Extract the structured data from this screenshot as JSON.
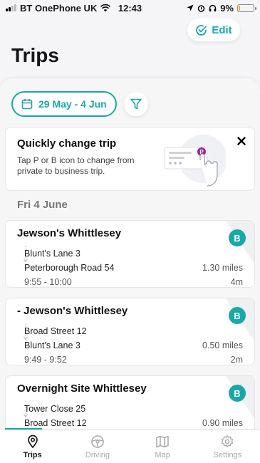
{
  "status_bar": {
    "carrier": "BT OnePhone UK",
    "time": "12:43",
    "battery_percent": "9%",
    "battery_level": 0.09
  },
  "header": {
    "edit_label": "Edit",
    "title": "Trips"
  },
  "filters": {
    "date_range": "29 May - 4 Jun"
  },
  "tip": {
    "title": "Quickly change trip",
    "body": "Tap P or B icon to change from private to business trip.",
    "badge_letter": "P"
  },
  "day_header": "Fri 4 June",
  "trips": [
    {
      "title": "Jewson's Whittlesey",
      "badge": "B",
      "from": "Blunt's Lane 3",
      "to": "Peterborough Road 54",
      "distance": "1.30 miles",
      "time_range": "9:55 - 10:00",
      "duration": "4m"
    },
    {
      "title": "- Jewson's Whittlesey",
      "badge": "B",
      "from": "Broad Street 12",
      "to": "Blunt's Lane 3",
      "distance": "0.50 miles",
      "time_range": "9:49 - 9:52",
      "duration": "2m"
    },
    {
      "title": "Overnight Site Whittlesey",
      "badge": "B",
      "from": "Tower Close 25",
      "to": "Broad Street 12",
      "distance": "0.90 miles",
      "time_range": "",
      "duration": ""
    }
  ],
  "tabs": [
    {
      "label": "Trips",
      "icon": "location-pin-icon"
    },
    {
      "label": "Driving",
      "icon": "steering-wheel-icon"
    },
    {
      "label": "Map",
      "icon": "map-icon"
    },
    {
      "label": "Settings",
      "icon": "gear-icon"
    }
  ],
  "colors": {
    "accent": "#1aa7a8",
    "private_badge": "#a020a0"
  }
}
